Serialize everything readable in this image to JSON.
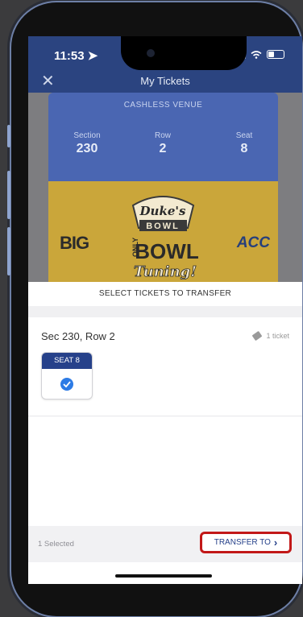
{
  "status_bar": {
    "time": "11:53"
  },
  "header": {
    "title": "My Tickets"
  },
  "ticket": {
    "venue": "CASHLESS VENUE",
    "section_label": "Section",
    "section": "230",
    "row_label": "Row",
    "row": "2",
    "seat_label": "Seat",
    "seat": "8"
  },
  "promo": {
    "left_logo": "BIG",
    "right_logo": "ACC",
    "bowl_line1": "Duke's",
    "bowl_line2": "BOWL",
    "bowl_side": "ONLY",
    "bowl_main": "BOWL",
    "bowl_bottom": "Tuning!"
  },
  "sheet": {
    "title": "SELECT TICKETS TO TRANSFER",
    "section_row": "Sec 230, Row 2",
    "ticket_count": "1 ticket",
    "seat_card_label": "SEAT 8",
    "seat_checked": true
  },
  "footer": {
    "selected_text": "1 Selected",
    "transfer_label": "TRANSFER TO"
  },
  "colors": {
    "navy": "#26418a",
    "check": "#2d7be5",
    "highlight": "#c21818"
  }
}
